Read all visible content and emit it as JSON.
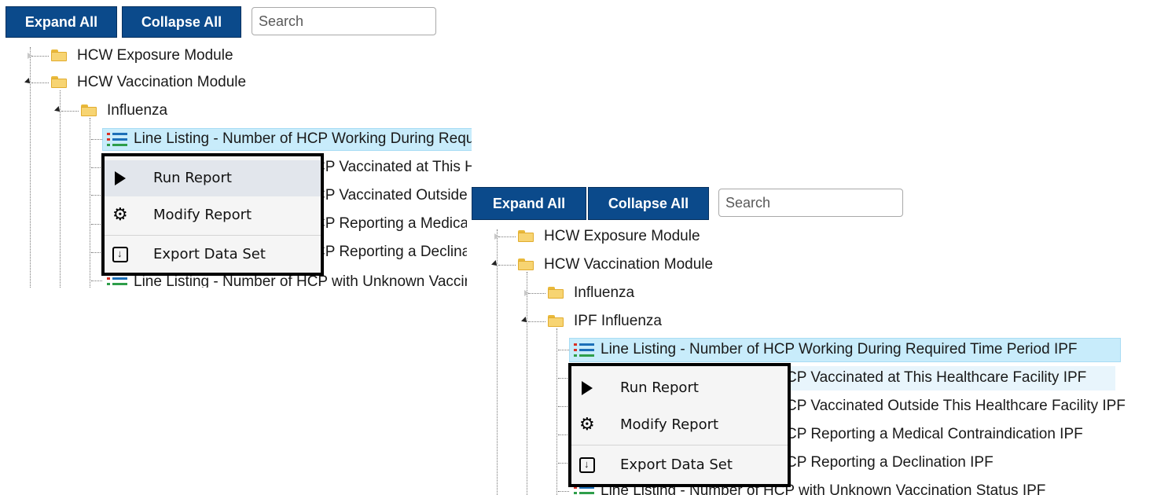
{
  "panel1": {
    "toolbar": {
      "expand_label": "Expand All",
      "collapse_label": "Collapse All",
      "search_placeholder": "Search"
    },
    "tree": {
      "exposure": "HCW Exposure Module",
      "vaccination": "HCW Vaccination Module",
      "influenza": "Influenza",
      "reports": [
        "Line Listing - Number of HCP Working During Required Time Period",
        "CP Vaccinated at This Healthcare Facility",
        "CP Vaccinated Outside This Healthcare Facility",
        "CP Reporting a Medical Contraindication",
        "CP Reporting a Declination",
        "Line Listing - Number of HCP with Unknown Vaccination Status"
      ]
    },
    "context_menu": {
      "run": "Run Report",
      "modify": "Modify Report",
      "export": "Export Data Set"
    }
  },
  "panel2": {
    "toolbar": {
      "expand_label": "Expand All",
      "collapse_label": "Collapse All",
      "search_placeholder": "Search"
    },
    "tree": {
      "exposure": "HCW Exposure Module",
      "vaccination": "HCW Vaccination Module",
      "influenza": "Influenza",
      "ipf_influenza": "IPF Influenza",
      "reports": [
        "Line Listing - Number of HCP Working During Required Time Period IPF",
        "CP Vaccinated at This Healthcare Facility IPF",
        "CP Vaccinated Outside This Healthcare Facility IPF",
        "CP Reporting a Medical Contraindication IPF",
        "CP Reporting a Declination IPF",
        "Line Listing - Number of HCP with Unknown Vaccination Status IPF"
      ]
    },
    "context_menu": {
      "run": "Run Report",
      "modify": "Modify Report",
      "export": "Export Data Set"
    }
  },
  "icons": {
    "play": "play-icon",
    "gear": "gear-icon",
    "export": "export-icon",
    "folder": "folder-icon",
    "report": "line-listing-icon"
  },
  "colors": {
    "button_bg": "#0b4a8b",
    "highlight": "#c8ecfb",
    "folder": "#f7d472"
  }
}
